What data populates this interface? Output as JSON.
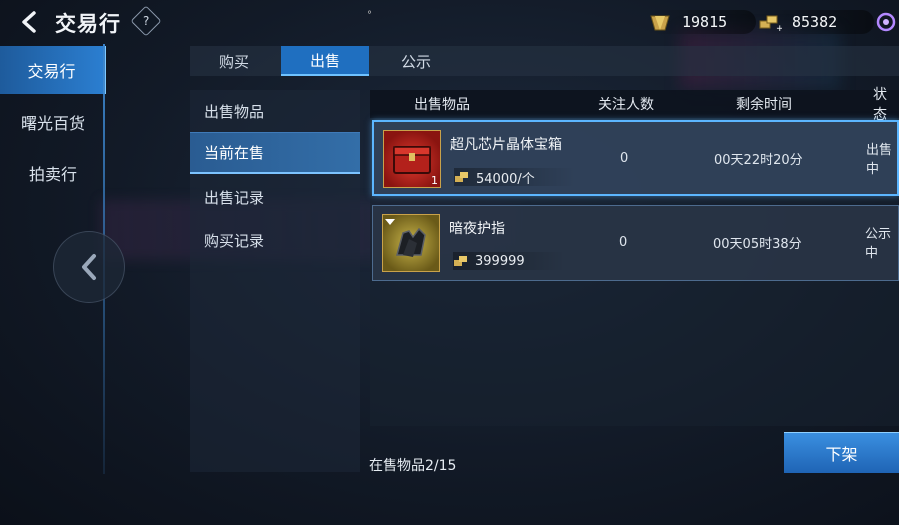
{
  "header": {
    "title": "交易行",
    "help_label": "?",
    "dot": "°"
  },
  "currencies": [
    {
      "icon": "diamond-currency-icon",
      "value": "19815"
    },
    {
      "icon": "gold-currency-icon",
      "value": "85382"
    },
    {
      "icon": "purple-currency-icon"
    }
  ],
  "left_nav": {
    "items": [
      {
        "label": "交易行",
        "active": true
      },
      {
        "label": "曙光百货",
        "active": false
      },
      {
        "label": "拍卖行",
        "active": false
      }
    ]
  },
  "tabs": [
    {
      "label": "购买",
      "active": false
    },
    {
      "label": "出售",
      "active": true
    },
    {
      "label": "公示",
      "active": false
    }
  ],
  "sub_menu": [
    {
      "label": "出售物品",
      "active": false
    },
    {
      "label": "当前在售",
      "active": true
    },
    {
      "label": "出售记录",
      "active": false
    },
    {
      "label": "购买记录",
      "active": false
    }
  ],
  "table": {
    "columns": [
      "出售物品",
      "关注人数",
      "剩余时间",
      "状态"
    ],
    "rows": [
      {
        "name": "超凡芯片晶体宝箱",
        "quantity": "1",
        "price": "54000/个",
        "followers": "0",
        "remaining": "00天22时20分",
        "status": "出售中",
        "selected": true
      },
      {
        "name": "暗夜护指",
        "quantity": "",
        "price": "399999",
        "followers": "0",
        "remaining": "00天05时38分",
        "status": "公示中",
        "selected": false
      }
    ]
  },
  "footer": {
    "count_text": "在售物品2/15",
    "delist_label": "下架"
  },
  "colors": {
    "accent": "#2b7ed0",
    "highlight": "#5cb6ff",
    "gold": "#c9a24a"
  }
}
